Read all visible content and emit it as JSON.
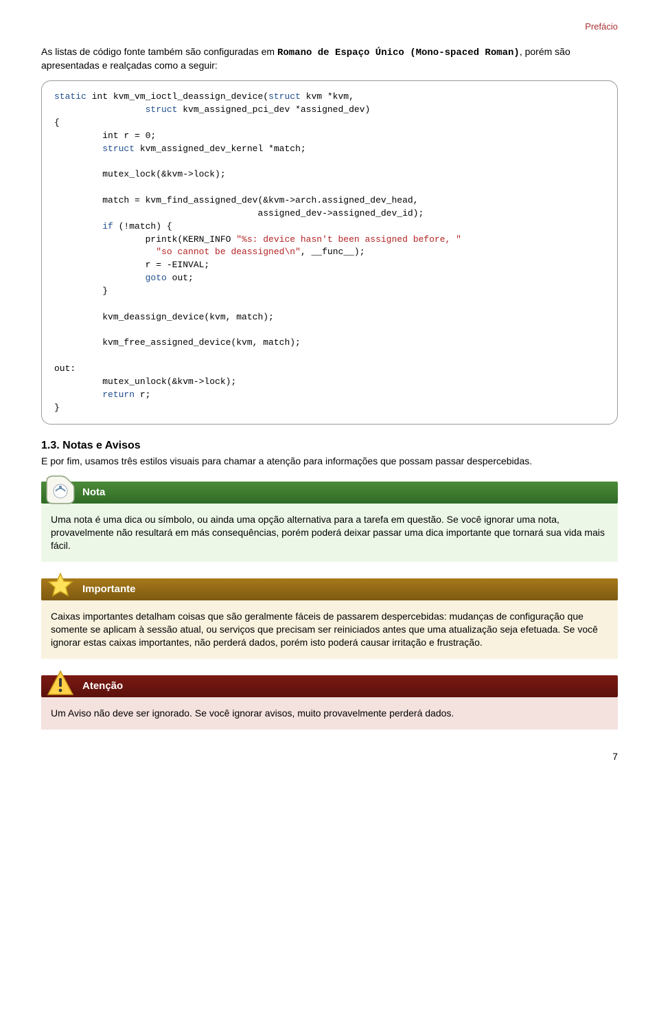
{
  "header": {
    "section_label": "Prefácio"
  },
  "intro": {
    "before_mono": "As listas de código fonte também são configuradas em ",
    "mono": "Romano de Espaço Único (Mono-spaced Roman)",
    "after_mono": ", porém são apresentadas e realçadas como a seguir:"
  },
  "code": {
    "l1a": "static",
    "l1b": " int kvm_vm_ioctl_deassign_device(",
    "l1c": "struct",
    "l1d": " kvm *kvm,",
    "l2a": "                 ",
    "l2b": "struct",
    "l2c": " kvm_assigned_pci_dev *assigned_dev)",
    "l3": "{",
    "l4": "         int r = 0;",
    "l5a": "         ",
    "l5b": "struct",
    "l5c": " kvm_assigned_dev_kernel *match;",
    "l6": "",
    "l7": "         mutex_lock(&kvm->lock);",
    "l8": "",
    "l9": "         match = kvm_find_assigned_dev(&kvm->arch.assigned_dev_head,",
    "l10": "                                      assigned_dev->assigned_dev_id);",
    "l11a": "         ",
    "l11b": "if",
    "l11c": " (!match) {",
    "l12a": "                 printk(KERN_INFO ",
    "l12b": "\"%s: device hasn't been assigned before, \"",
    "l13a": "                   ",
    "l13b": "\"so cannot be deassigned",
    "l13c": "\\n",
    "l13d": "\"",
    "l13e": ", __func__);",
    "l14": "                 r = -EINVAL;",
    "l15a": "                 ",
    "l15b": "goto",
    "l15c": " out;",
    "l16": "         }",
    "l17": "",
    "l18": "         kvm_deassign_device(kvm, match);",
    "l19": "",
    "l20": "         kvm_free_assigned_device(kvm, match);",
    "l21": "",
    "l22": "out:",
    "l23": "         mutex_unlock(&kvm->lock);",
    "l24a": "         ",
    "l24b": "return",
    "l24c": " r;",
    "l25": "}"
  },
  "section": {
    "heading": "1.3. Notas e Avisos",
    "body": "E por fim, usamos três estilos visuais para chamar a atenção para informações que possam passar despercebidas."
  },
  "note": {
    "title": "Nota",
    "body": "Uma nota é uma dica ou símbolo, ou ainda uma opção alternativa para a tarefa em questão. Se você ignorar uma nota, provavelmente não resultará em más consequências, porém poderá deixar passar uma dica importante que tornará sua vida mais fácil."
  },
  "important": {
    "title": "Importante",
    "body": "Caixas importantes detalham coisas que são geralmente fáceis de passarem despercebidas: mudanças de configuração que somente se aplicam à sessão atual, ou serviços que precisam ser reiniciados antes que uma atualização seja efetuada. Se você ignorar estas caixas importantes, não perderá dados, porém isto poderá causar irritação e frustração."
  },
  "warning": {
    "title": "Atenção",
    "body": "Um Aviso não deve ser ignorado. Se você ignorar avisos, muito provavelmente perderá dados."
  },
  "footer": {
    "page_number": "7"
  }
}
